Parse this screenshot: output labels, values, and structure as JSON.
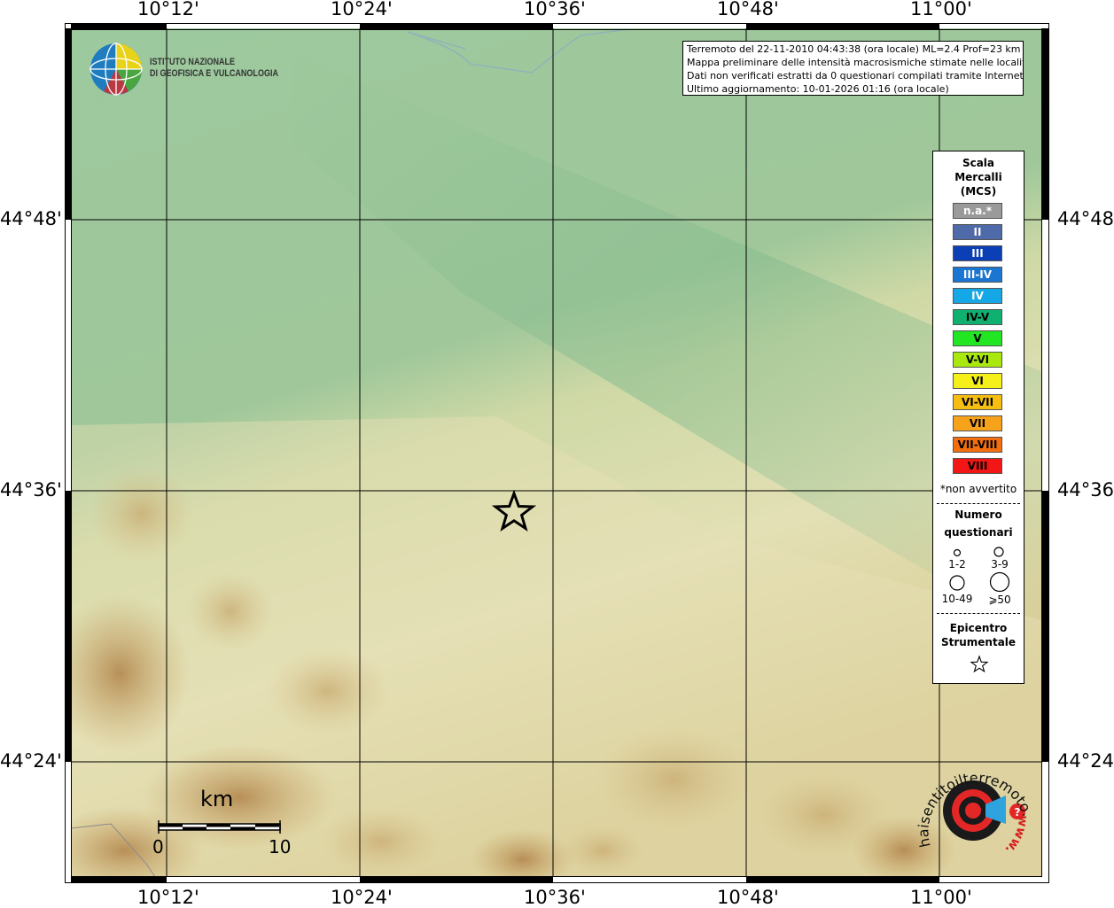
{
  "map": {
    "longitude_labels": [
      "10°12'",
      "10°24'",
      "10°36'",
      "10°48'",
      "11°00'"
    ],
    "latitude_labels": [
      "44°48'",
      "44°36'",
      "44°24'"
    ]
  },
  "logo": {
    "line1": "ISTITUTO NAZIONALE",
    "line2": "DI GEOFISICA E VULCANOLOGIA"
  },
  "info": {
    "line1": "Terremoto del 22-11-2010 04:43:38 (ora locale) ML=2.4 Prof=23 km",
    "line2": "Mappa preliminare delle intensità macrosismiche stimate nelle località",
    "line3": "Dati non verificati estratti da 0 questionari compilati tramite Internet.",
    "line4": "Ultimo aggiornamento: 10-01-2026 01:16 (ora locale)"
  },
  "legend": {
    "title_line1": "Scala",
    "title_line2": "Mercalli",
    "title_line3": "(MCS)",
    "items": [
      {
        "label": "n.a.*",
        "color": "#9a9a9a",
        "text_color": "#ffffff"
      },
      {
        "label": "II",
        "color": "#4e6aa8",
        "text_color": "#ffffff"
      },
      {
        "label": "III",
        "color": "#0b3fb5",
        "text_color": "#ffffff"
      },
      {
        "label": "III-IV",
        "color": "#1b76d1",
        "text_color": "#ffffff"
      },
      {
        "label": "IV",
        "color": "#16a8e6",
        "text_color": "#ffffff"
      },
      {
        "label": "IV-V",
        "color": "#0fb070",
        "text_color": "#000000"
      },
      {
        "label": "V",
        "color": "#22e622",
        "text_color": "#000000"
      },
      {
        "label": "V-VI",
        "color": "#a8e80f",
        "text_color": "#000000"
      },
      {
        "label": "VI",
        "color": "#f5f01a",
        "text_color": "#000000"
      },
      {
        "label": "VI-VII",
        "color": "#f5be10",
        "text_color": "#000000"
      },
      {
        "label": "VII",
        "color": "#f7a21b",
        "text_color": "#000000"
      },
      {
        "label": "VII-VIII",
        "color": "#f46e0e",
        "text_color": "#000000"
      },
      {
        "label": "VIII",
        "color": "#f21616",
        "text_color": "#000000"
      }
    ],
    "note": "*non avvertito",
    "count_title_line1": "Numero",
    "count_title_line2": "questionari",
    "counts": [
      "1-2",
      "3-9",
      "10-49",
      "⩾50"
    ],
    "epicenter_line1": "Epicentro",
    "epicenter_line2": "Strumentale"
  },
  "scalebar": {
    "unit": "km",
    "start": "0",
    "end": "10"
  },
  "watermark": {
    "text": "haisentitoilterremoto.it",
    "prefix": "www."
  }
}
